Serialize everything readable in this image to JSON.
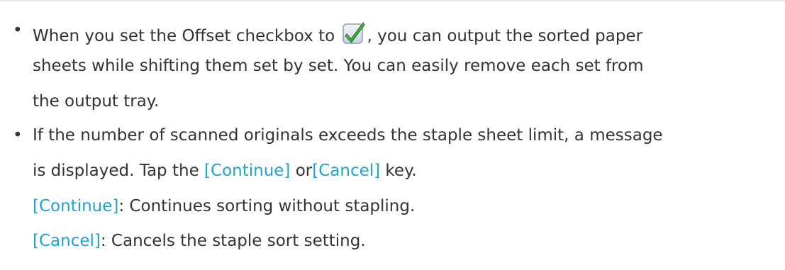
{
  "bullet_glyph": "•",
  "item1": {
    "line1_pre": "When you set the Offset checkbox to",
    "checkbox_icon": "checkmark-icon",
    "line1_post": ", you can output the sorted paper",
    "line2": "sheets while shifting them set by set. You can easily remove each set from",
    "line3": "the output tray."
  },
  "item2": {
    "line1": "If the number of scanned originals exceeds the staple sheet limit, a message",
    "line2_pre": "is displayed. Tap the ",
    "continue_key": "[Continue]",
    "line2_mid": " or",
    "cancel_key": "[Cancel]",
    "line2_post": " key.",
    "continue_desc_key": "[Continue]",
    "continue_desc": ": Continues sorting without stapling.",
    "cancel_desc_key": "[Cancel]",
    "cancel_desc": ": Cancels the staple sort setting."
  },
  "colors": {
    "text": "#333333",
    "link": "#1ea2d6",
    "check_green": "#2f9e2f"
  }
}
